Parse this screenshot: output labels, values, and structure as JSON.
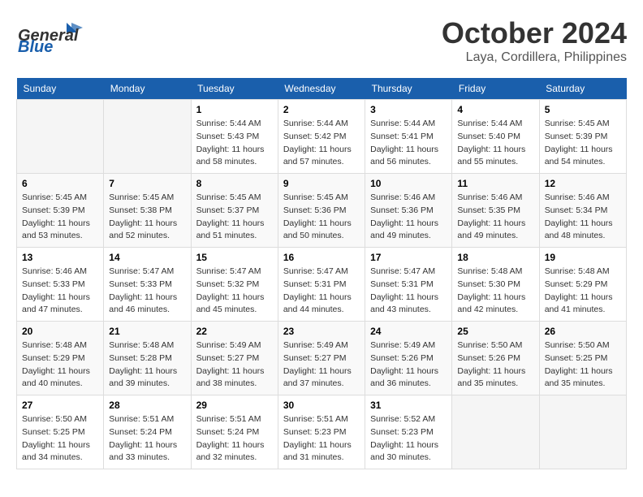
{
  "header": {
    "logo_general": "General",
    "logo_blue": "Blue",
    "month": "October 2024",
    "location": "Laya, Cordillera, Philippines"
  },
  "weekdays": [
    "Sunday",
    "Monday",
    "Tuesday",
    "Wednesday",
    "Thursday",
    "Friday",
    "Saturday"
  ],
  "weeks": [
    [
      {
        "day": "",
        "sunrise": "",
        "sunset": "",
        "daylight": ""
      },
      {
        "day": "",
        "sunrise": "",
        "sunset": "",
        "daylight": ""
      },
      {
        "day": "1",
        "sunrise": "Sunrise: 5:44 AM",
        "sunset": "Sunset: 5:43 PM",
        "daylight": "Daylight: 11 hours and 58 minutes."
      },
      {
        "day": "2",
        "sunrise": "Sunrise: 5:44 AM",
        "sunset": "Sunset: 5:42 PM",
        "daylight": "Daylight: 11 hours and 57 minutes."
      },
      {
        "day": "3",
        "sunrise": "Sunrise: 5:44 AM",
        "sunset": "Sunset: 5:41 PM",
        "daylight": "Daylight: 11 hours and 56 minutes."
      },
      {
        "day": "4",
        "sunrise": "Sunrise: 5:44 AM",
        "sunset": "Sunset: 5:40 PM",
        "daylight": "Daylight: 11 hours and 55 minutes."
      },
      {
        "day": "5",
        "sunrise": "Sunrise: 5:45 AM",
        "sunset": "Sunset: 5:39 PM",
        "daylight": "Daylight: 11 hours and 54 minutes."
      }
    ],
    [
      {
        "day": "6",
        "sunrise": "Sunrise: 5:45 AM",
        "sunset": "Sunset: 5:39 PM",
        "daylight": "Daylight: 11 hours and 53 minutes."
      },
      {
        "day": "7",
        "sunrise": "Sunrise: 5:45 AM",
        "sunset": "Sunset: 5:38 PM",
        "daylight": "Daylight: 11 hours and 52 minutes."
      },
      {
        "day": "8",
        "sunrise": "Sunrise: 5:45 AM",
        "sunset": "Sunset: 5:37 PM",
        "daylight": "Daylight: 11 hours and 51 minutes."
      },
      {
        "day": "9",
        "sunrise": "Sunrise: 5:45 AM",
        "sunset": "Sunset: 5:36 PM",
        "daylight": "Daylight: 11 hours and 50 minutes."
      },
      {
        "day": "10",
        "sunrise": "Sunrise: 5:46 AM",
        "sunset": "Sunset: 5:36 PM",
        "daylight": "Daylight: 11 hours and 49 minutes."
      },
      {
        "day": "11",
        "sunrise": "Sunrise: 5:46 AM",
        "sunset": "Sunset: 5:35 PM",
        "daylight": "Daylight: 11 hours and 49 minutes."
      },
      {
        "day": "12",
        "sunrise": "Sunrise: 5:46 AM",
        "sunset": "Sunset: 5:34 PM",
        "daylight": "Daylight: 11 hours and 48 minutes."
      }
    ],
    [
      {
        "day": "13",
        "sunrise": "Sunrise: 5:46 AM",
        "sunset": "Sunset: 5:33 PM",
        "daylight": "Daylight: 11 hours and 47 minutes."
      },
      {
        "day": "14",
        "sunrise": "Sunrise: 5:47 AM",
        "sunset": "Sunset: 5:33 PM",
        "daylight": "Daylight: 11 hours and 46 minutes."
      },
      {
        "day": "15",
        "sunrise": "Sunrise: 5:47 AM",
        "sunset": "Sunset: 5:32 PM",
        "daylight": "Daylight: 11 hours and 45 minutes."
      },
      {
        "day": "16",
        "sunrise": "Sunrise: 5:47 AM",
        "sunset": "Sunset: 5:31 PM",
        "daylight": "Daylight: 11 hours and 44 minutes."
      },
      {
        "day": "17",
        "sunrise": "Sunrise: 5:47 AM",
        "sunset": "Sunset: 5:31 PM",
        "daylight": "Daylight: 11 hours and 43 minutes."
      },
      {
        "day": "18",
        "sunrise": "Sunrise: 5:48 AM",
        "sunset": "Sunset: 5:30 PM",
        "daylight": "Daylight: 11 hours and 42 minutes."
      },
      {
        "day": "19",
        "sunrise": "Sunrise: 5:48 AM",
        "sunset": "Sunset: 5:29 PM",
        "daylight": "Daylight: 11 hours and 41 minutes."
      }
    ],
    [
      {
        "day": "20",
        "sunrise": "Sunrise: 5:48 AM",
        "sunset": "Sunset: 5:29 PM",
        "daylight": "Daylight: 11 hours and 40 minutes."
      },
      {
        "day": "21",
        "sunrise": "Sunrise: 5:48 AM",
        "sunset": "Sunset: 5:28 PM",
        "daylight": "Daylight: 11 hours and 39 minutes."
      },
      {
        "day": "22",
        "sunrise": "Sunrise: 5:49 AM",
        "sunset": "Sunset: 5:27 PM",
        "daylight": "Daylight: 11 hours and 38 minutes."
      },
      {
        "day": "23",
        "sunrise": "Sunrise: 5:49 AM",
        "sunset": "Sunset: 5:27 PM",
        "daylight": "Daylight: 11 hours and 37 minutes."
      },
      {
        "day": "24",
        "sunrise": "Sunrise: 5:49 AM",
        "sunset": "Sunset: 5:26 PM",
        "daylight": "Daylight: 11 hours and 36 minutes."
      },
      {
        "day": "25",
        "sunrise": "Sunrise: 5:50 AM",
        "sunset": "Sunset: 5:26 PM",
        "daylight": "Daylight: 11 hours and 35 minutes."
      },
      {
        "day": "26",
        "sunrise": "Sunrise: 5:50 AM",
        "sunset": "Sunset: 5:25 PM",
        "daylight": "Daylight: 11 hours and 35 minutes."
      }
    ],
    [
      {
        "day": "27",
        "sunrise": "Sunrise: 5:50 AM",
        "sunset": "Sunset: 5:25 PM",
        "daylight": "Daylight: 11 hours and 34 minutes."
      },
      {
        "day": "28",
        "sunrise": "Sunrise: 5:51 AM",
        "sunset": "Sunset: 5:24 PM",
        "daylight": "Daylight: 11 hours and 33 minutes."
      },
      {
        "day": "29",
        "sunrise": "Sunrise: 5:51 AM",
        "sunset": "Sunset: 5:24 PM",
        "daylight": "Daylight: 11 hours and 32 minutes."
      },
      {
        "day": "30",
        "sunrise": "Sunrise: 5:51 AM",
        "sunset": "Sunset: 5:23 PM",
        "daylight": "Daylight: 11 hours and 31 minutes."
      },
      {
        "day": "31",
        "sunrise": "Sunrise: 5:52 AM",
        "sunset": "Sunset: 5:23 PM",
        "daylight": "Daylight: 11 hours and 30 minutes."
      },
      {
        "day": "",
        "sunrise": "",
        "sunset": "",
        "daylight": ""
      },
      {
        "day": "",
        "sunrise": "",
        "sunset": "",
        "daylight": ""
      }
    ]
  ]
}
